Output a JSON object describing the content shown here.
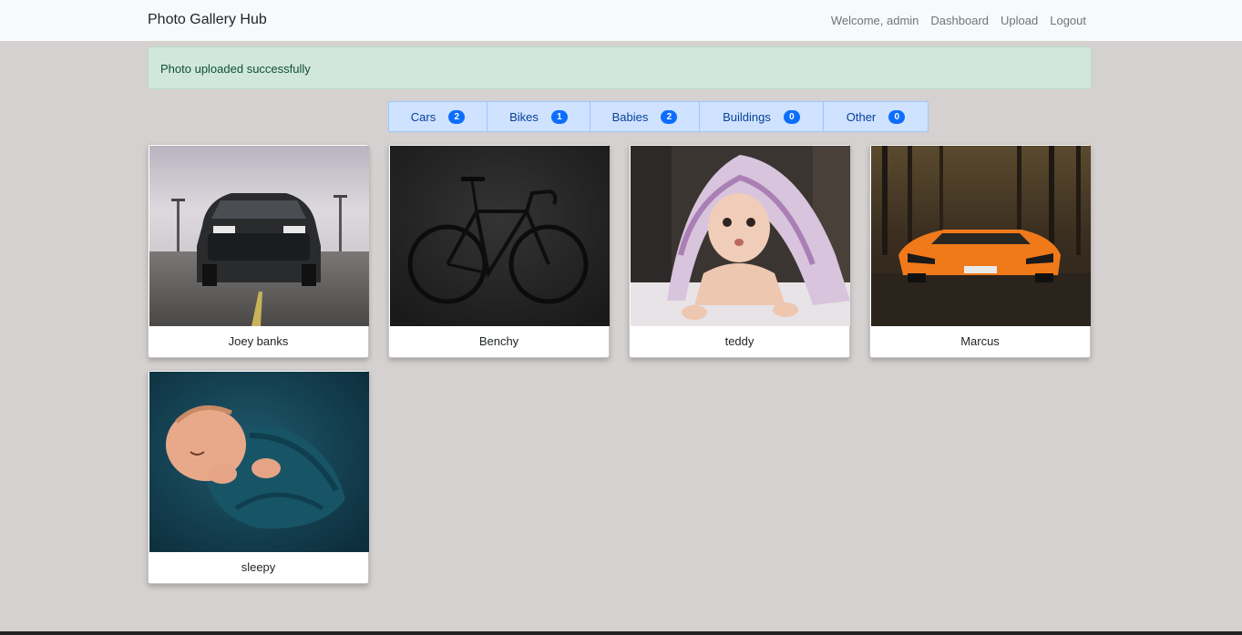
{
  "navbar": {
    "brand": "Photo Gallery Hub",
    "welcome": "Welcome, admin",
    "dashboard": "Dashboard",
    "upload": "Upload",
    "logout": "Logout"
  },
  "alert": {
    "message": "Photo uploaded successfully",
    "color": "#d1e7dd"
  },
  "categories": [
    {
      "label": "Cars",
      "count": "2"
    },
    {
      "label": "Bikes",
      "count": "1"
    },
    {
      "label": "Babies",
      "count": "2"
    },
    {
      "label": "Buildings",
      "count": "0"
    },
    {
      "label": "Other",
      "count": "0"
    }
  ],
  "photos": [
    {
      "caption": "Joey banks",
      "subject": "car-photo"
    },
    {
      "caption": "Benchy",
      "subject": "bike-photo"
    },
    {
      "caption": "teddy",
      "subject": "baby-photo"
    },
    {
      "caption": "Marcus",
      "subject": "car-photo"
    },
    {
      "caption": "sleepy",
      "subject": "baby-photo"
    }
  ],
  "colors": {
    "accent": "#0d6efd",
    "background": "#d5d1d0"
  }
}
